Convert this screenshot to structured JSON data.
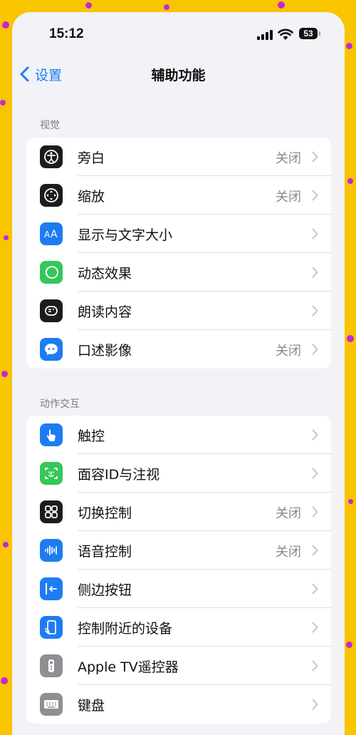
{
  "status": {
    "time": "15:12",
    "battery": "53"
  },
  "nav": {
    "back_label": "设置",
    "title": "辅助功能"
  },
  "sections": [
    {
      "header": "视觉",
      "items": [
        {
          "label": "旁白",
          "value": "关闭",
          "icon": "voiceover-icon",
          "color": "#1c1c1e"
        },
        {
          "label": "缩放",
          "value": "关闭",
          "icon": "zoom-icon",
          "color": "#1c1c1e"
        },
        {
          "label": "显示与文字大小",
          "value": "",
          "icon": "text-size-icon",
          "color": "#1e7cf2"
        },
        {
          "label": "动态效果",
          "value": "",
          "icon": "motion-icon",
          "color": "#34c759"
        },
        {
          "label": "朗读内容",
          "value": "",
          "icon": "spoken-content-icon",
          "color": "#1c1c1e"
        },
        {
          "label": "口述影像",
          "value": "关闭",
          "icon": "audio-descriptions-icon",
          "color": "#1e7cf2"
        }
      ]
    },
    {
      "header": "动作交互",
      "items": [
        {
          "label": "触控",
          "value": "",
          "icon": "touch-icon",
          "color": "#1e7cf2"
        },
        {
          "label": "面容ID与注视",
          "value": "",
          "icon": "face-id-icon",
          "color": "#34c759"
        },
        {
          "label": "切换控制",
          "value": "关闭",
          "icon": "switch-control-icon",
          "color": "#1c1c1e"
        },
        {
          "label": "语音控制",
          "value": "关闭",
          "icon": "voice-control-icon",
          "color": "#1e7cf2"
        },
        {
          "label": "侧边按钮",
          "value": "",
          "icon": "side-button-icon",
          "color": "#1e7cf2"
        },
        {
          "label": "控制附近的设备",
          "value": "",
          "icon": "nearby-devices-icon",
          "color": "#1e7cf2"
        },
        {
          "label": "Apple TV遥控器",
          "value": "",
          "icon": "tv-remote-icon",
          "color": "#8e8e93"
        },
        {
          "label": "键盘",
          "value": "",
          "icon": "keyboard-icon",
          "color": "#8e8e93"
        }
      ]
    }
  ]
}
